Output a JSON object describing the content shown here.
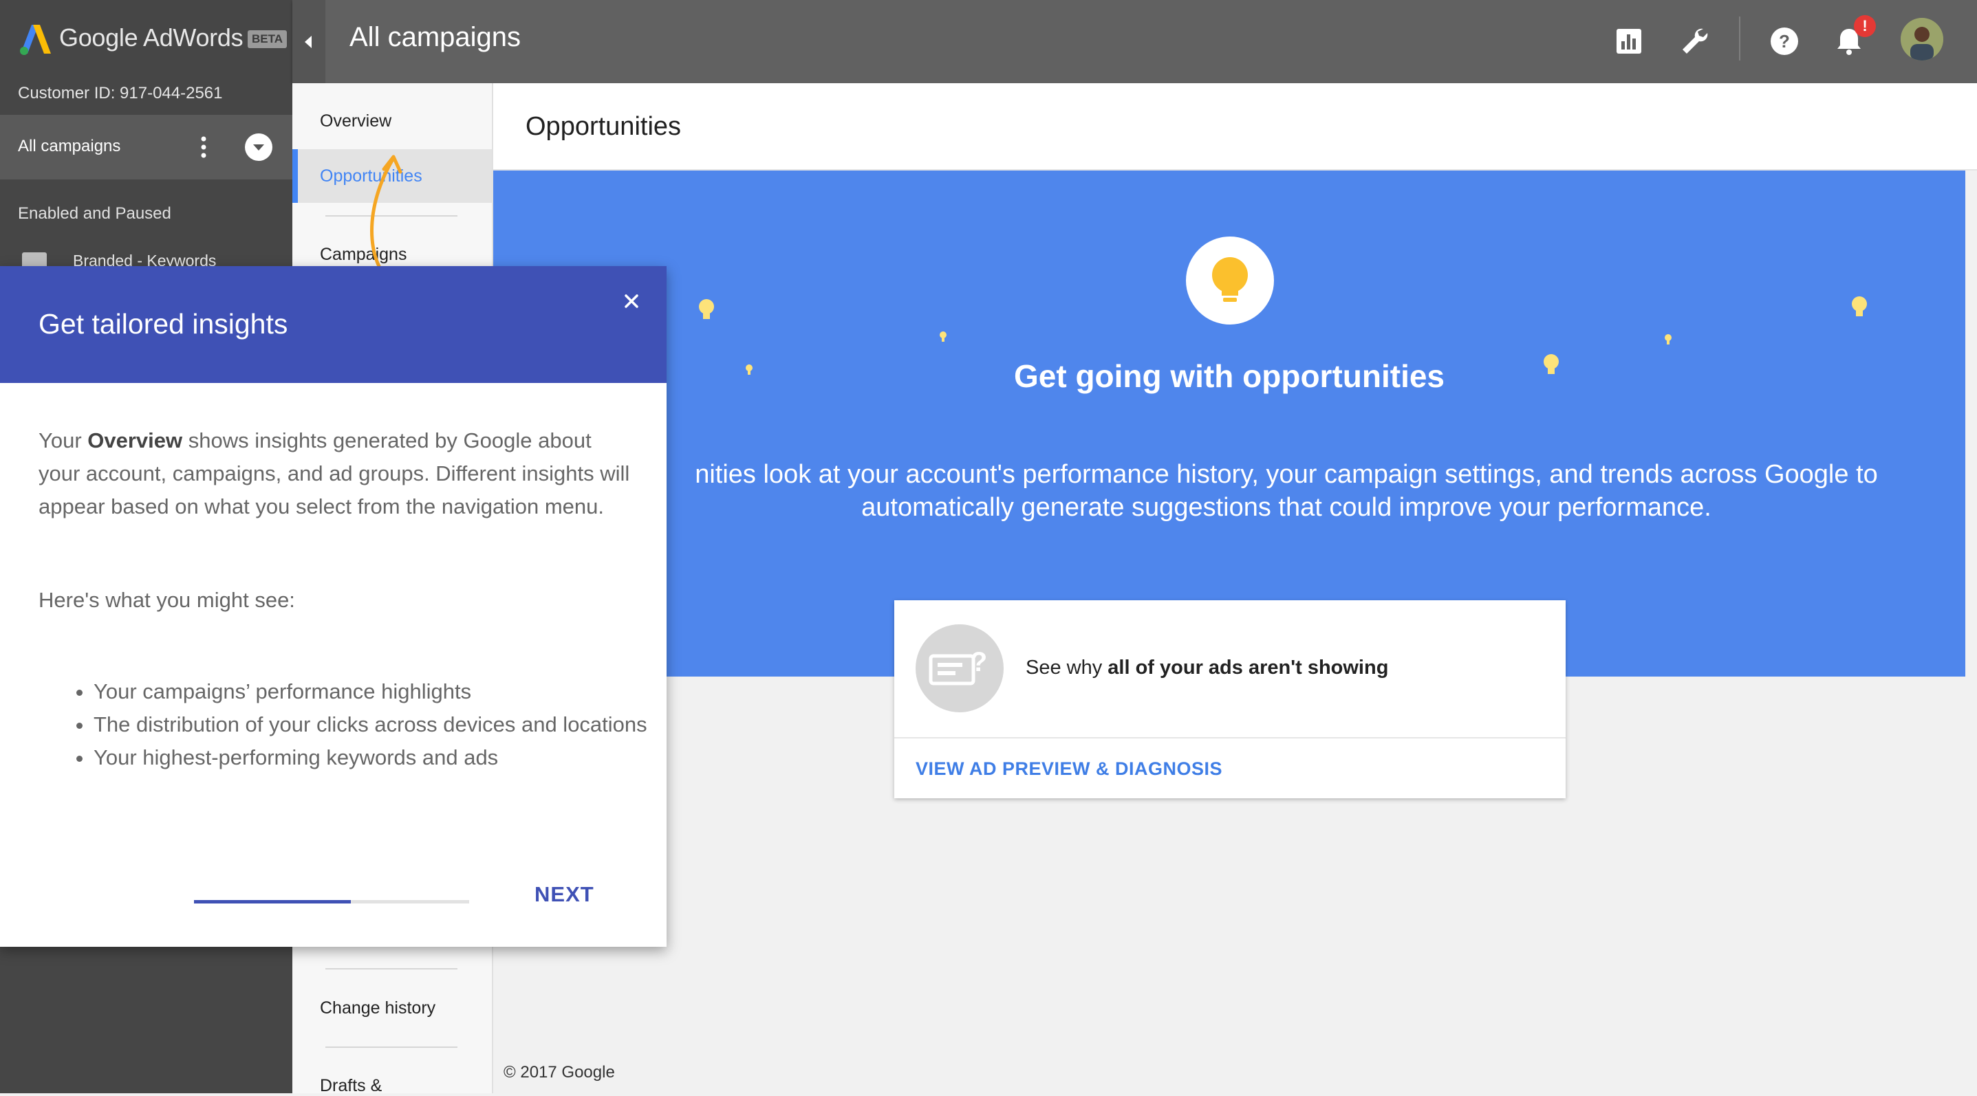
{
  "app": {
    "brand": "Google AdWords",
    "beta_badge": "BETA",
    "customer_id": "Customer ID: 917-044-2561"
  },
  "sidebar": {
    "selected_scope": "All campaigns",
    "section_label": "Enabled and Paused",
    "items": [
      {
        "label": "Branded - Keywords",
        "icon": "search-campaign-icon"
      }
    ]
  },
  "topbar": {
    "title": "All campaigns",
    "icons": [
      "reports-icon",
      "tools-wrench-icon",
      "help-icon",
      "notifications-bell-icon",
      "avatar"
    ],
    "notification_badge": "!"
  },
  "nav2": {
    "items": [
      {
        "label": "Overview"
      },
      {
        "label": "Opportunities",
        "active": true
      },
      {
        "label": "Campaigns"
      },
      {
        "label": "Change history"
      },
      {
        "label": "Drafts &"
      }
    ]
  },
  "main": {
    "title": "Opportunities",
    "banner": {
      "headline": "Get going with opportunities",
      "description": "nities look at your account's performance history, your campaign settings, and trends across Google to automatically generate suggestions that could improve your performance.",
      "colors": {
        "background": "#4f86ec",
        "bulb": "#fbc02d"
      }
    },
    "card": {
      "text_prefix": "See why ",
      "text_bold": "all of your ads aren't showing",
      "link": "VIEW AD PREVIEW & DIAGNOSIS"
    },
    "footer": "© 2017 Google"
  },
  "dialog": {
    "title": "Get tailored insights",
    "body_prefix": "Your ",
    "body_bold": "Overview",
    "body_rest": " shows insights generated by Google about your account, campaigns, and ad groups. Different insights will appear based on what you select from the navigation menu.",
    "subheading": "Here's what you might see:",
    "bullets": [
      "Your campaigns’ performance highlights",
      "The distribution of your clicks across devices and locations",
      "Your highest-performing keywords and ads"
    ],
    "progress": 0.57,
    "next_label": "NEXT"
  },
  "colors": {
    "accent_blue": "#4285f4",
    "dialog_header": "#3f51b5",
    "sidebar_bg": "#464646",
    "topbar_bg": "#616161"
  }
}
